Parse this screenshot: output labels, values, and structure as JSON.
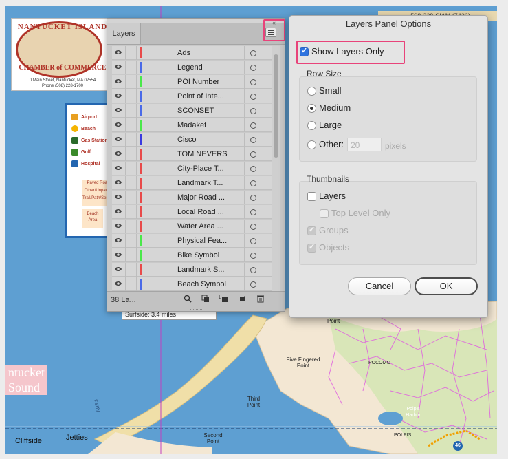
{
  "map": {
    "chamber_name_top": "NANTUCKET ISLAND",
    "chamber_name_bottom": "CHAMBER of COMMERCE",
    "chamber_address": "0 Main Street, Nantucket, MA 02554",
    "chamber_phone": "Phone (508) 228-1700",
    "top_right_phone": "508-228-SIAM (7426)",
    "legend": {
      "items": [
        {
          "label": "Airport",
          "color": "#e8a020"
        },
        {
          "label": "Beach",
          "color": "#f5b400"
        },
        {
          "label": "Gas Station",
          "color": "#2a6a2a"
        },
        {
          "label": "Golf",
          "color": "#3a8a2a"
        },
        {
          "label": "Hospital",
          "color": "#2366b0"
        }
      ],
      "paved_road": "Paved Road",
      "other_unpaved": "Other/Unpaved",
      "trail": "Trail/Path/Service",
      "beach_area": "Beach Area"
    },
    "surfside": "Surfside: 3.4 miles",
    "nantucket_sound_1": "ntucket",
    "nantucket_sound_2": "Sound",
    "cliffside": "Cliffside",
    "jetties": "Jetties",
    "ferry": "Ferry",
    "labels": {
      "five_fingered": "Five Fingered Point",
      "third_point": "Third Point",
      "second_point": "Second Point",
      "point": "Point",
      "pocomo": "POCOMO",
      "polpis_harbor": "Polpis Harbor",
      "polpis": "POLPIS",
      "route": "46"
    }
  },
  "layers_panel": {
    "tab_label": "Layers",
    "close_glyph": "«",
    "layer_count": "38 La...",
    "layers": [
      {
        "name": "Ads",
        "color": "#e84a4a"
      },
      {
        "name": "Legend",
        "color": "#4a6ae8"
      },
      {
        "name": "POI Number",
        "color": "#4ae84a"
      },
      {
        "name": "Point of Inte...",
        "color": "#4a6ae8"
      },
      {
        "name": "SCONSET",
        "color": "#4a6ae8"
      },
      {
        "name": "Madaket",
        "color": "#4ae84a"
      },
      {
        "name": "Cisco",
        "color": "#3a3ae0"
      },
      {
        "name": "TOM NEVERS",
        "color": "#e84a4a"
      },
      {
        "name": "City-Place T...",
        "color": "#e84a4a"
      },
      {
        "name": "Landmark T...",
        "color": "#e84a4a"
      },
      {
        "name": "Major Road ...",
        "color": "#e84a4a"
      },
      {
        "name": "Local Road ...",
        "color": "#e84a4a"
      },
      {
        "name": "Water Area ...",
        "color": "#e84a4a"
      },
      {
        "name": "Physical Fea...",
        "color": "#4ae84a"
      },
      {
        "name": "Bike Symbol",
        "color": "#4ae84a"
      },
      {
        "name": "Landmark S...",
        "color": "#e84a4a"
      },
      {
        "name": "Beach Symbol",
        "color": "#4a6ae8"
      }
    ]
  },
  "dialog": {
    "title": "Layers Panel Options",
    "show_layers_only": "Show Layers Only",
    "row_size": {
      "title": "Row Size",
      "small": "Small",
      "medium": "Medium",
      "large": "Large",
      "other": "Other:",
      "other_value": "20",
      "pixels": "pixels",
      "selected": "Medium"
    },
    "thumbnails": {
      "title": "Thumbnails",
      "layers": "Layers",
      "top_level_only": "Top Level Only",
      "groups": "Groups",
      "objects": "Objects"
    },
    "cancel": "Cancel",
    "ok": "OK"
  }
}
